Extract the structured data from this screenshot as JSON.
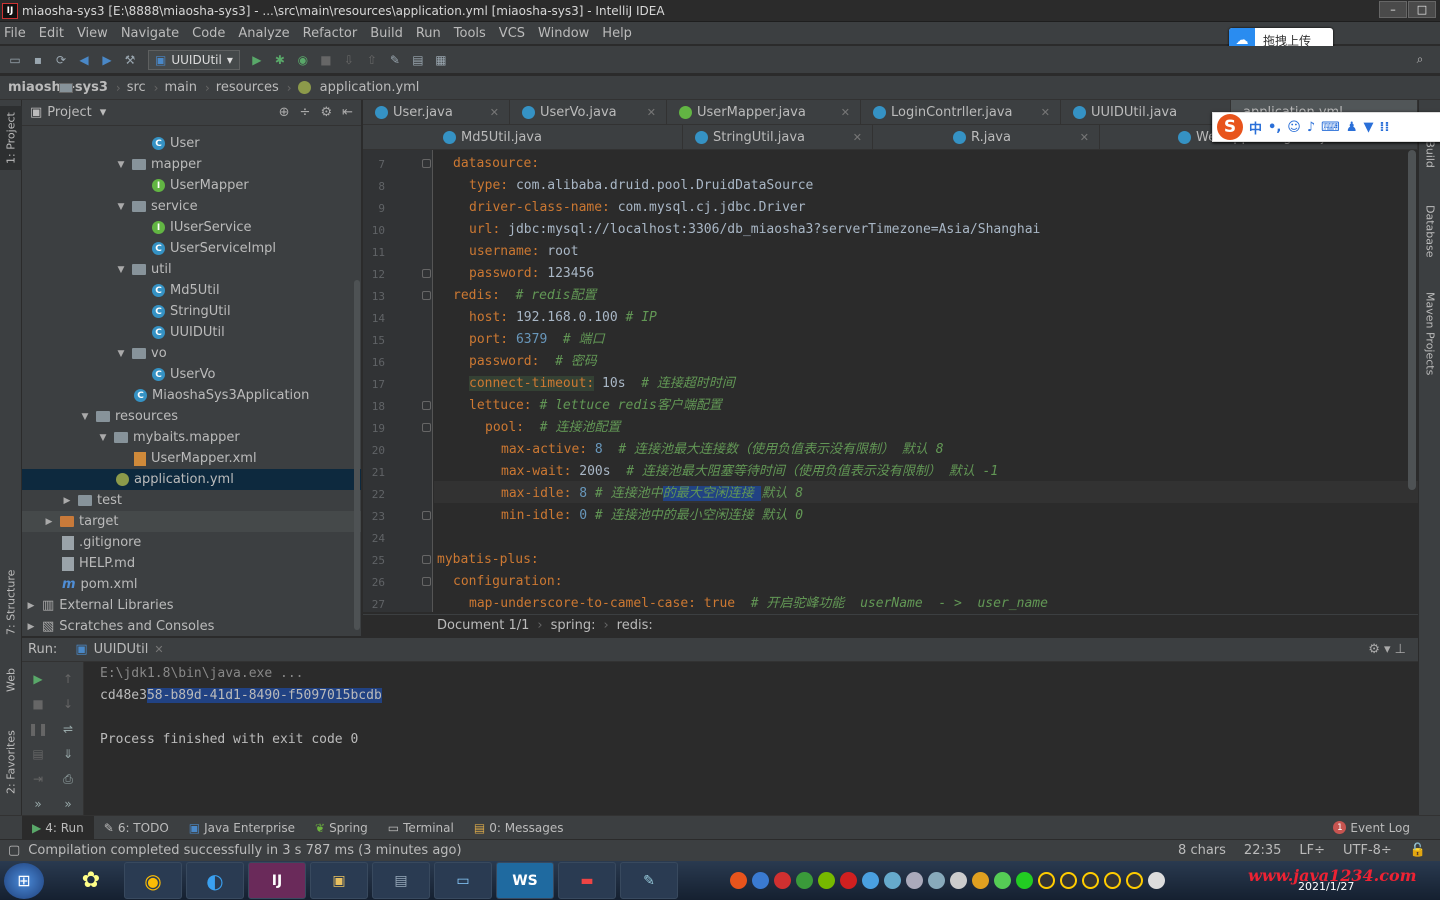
{
  "window": {
    "title": "miaosha-sys3 [E:\\8888\\miaosha-sys3] - ...\\src\\main\\resources\\application.yml [miaosha-sys3] - IntelliJ IDEA",
    "controls": [
      "–",
      "□",
      "✕"
    ]
  },
  "menu": [
    "File",
    "Edit",
    "View",
    "Navigate",
    "Code",
    "Analyze",
    "Refactor",
    "Build",
    "Run",
    "Tools",
    "VCS",
    "Window",
    "Help"
  ],
  "upload_widget": {
    "label": "拖拽上传"
  },
  "toolbar": {
    "run_config": "UUIDUtil"
  },
  "breadcrumb": [
    "miaosha-sys3",
    "src",
    "main",
    "resources",
    "application.yml"
  ],
  "project_panel": {
    "title": "Project",
    "items": [
      {
        "label": "User",
        "indent": 8
      },
      {
        "label": "mapper",
        "indent": 6
      },
      {
        "label": "UserMapper",
        "indent": 8
      },
      {
        "label": "service",
        "indent": 6
      },
      {
        "label": "IUserService",
        "indent": 8
      },
      {
        "label": "UserServiceImpl",
        "indent": 8
      },
      {
        "label": "util",
        "indent": 6
      },
      {
        "label": "Md5Util",
        "indent": 8
      },
      {
        "label": "StringUtil",
        "indent": 8
      },
      {
        "label": "UUIDUtil",
        "indent": 8
      },
      {
        "label": "vo",
        "indent": 6
      },
      {
        "label": "UserVo",
        "indent": 8
      },
      {
        "label": "MiaoshaSys3Application",
        "indent": 7
      },
      {
        "label": "resources",
        "indent": 4
      },
      {
        "label": "mybaits.mapper",
        "indent": 5
      },
      {
        "label": "UserMapper.xml",
        "indent": 7
      },
      {
        "label": "application.yml",
        "indent": 6
      },
      {
        "label": "test",
        "indent": 3
      },
      {
        "label": "target",
        "indent": 2
      },
      {
        "label": ".gitignore",
        "indent": 3
      },
      {
        "label": "HELP.md",
        "indent": 3
      },
      {
        "label": "pom.xml",
        "indent": 3
      },
      {
        "label": "External Libraries",
        "indent": 1
      },
      {
        "label": "Scratches and Consoles",
        "indent": 1
      }
    ]
  },
  "tabs_row1": [
    "User.java",
    "UserVo.java",
    "UserMapper.java",
    "LoginContrller.java",
    "UUIDUtil.java",
    "application.yml"
  ],
  "tabs_row2": [
    "Md5Util.java",
    "StringUtil.java",
    "R.java",
    "WebAppConfigurer.java"
  ],
  "editor": {
    "line_numbers": [
      "7",
      "8",
      "9",
      "10",
      "11",
      "12",
      "13",
      "14",
      "15",
      "16",
      "17",
      "18",
      "19",
      "20",
      "21",
      "22",
      "23",
      "24",
      "25",
      "26",
      "27"
    ],
    "breadcrumb": [
      "Document 1/1",
      "spring:",
      "redis:"
    ]
  },
  "left_tool_windows": [
    "1: Project",
    "7: Structure",
    "Web",
    "2: Favorites"
  ],
  "right_tool_windows": [
    "Ant Build",
    "Database",
    "Maven Projects"
  ],
  "run_panel": {
    "label": "Run:",
    "tab": "UUIDUtil",
    "console": [
      "E:\\jdk1.8\\bin\\java.exe ...",
      "cd48e358-b89d-41d1-8490-f5097015bcdb",
      "",
      "Process finished with exit code 0"
    ]
  },
  "bottom_tabs": [
    "4: Run",
    "6: TODO",
    "Java Enterprise",
    "Spring",
    "Terminal",
    "0: Messages"
  ],
  "event_log": {
    "count": "1",
    "label": "Event Log"
  },
  "status": {
    "message": "Compilation completed successfully in 3 s 787 ms (3 minutes ago)",
    "chars": "8 chars",
    "position": "22:35",
    "line_sep": "LF÷",
    "encoding": "UTF-8÷"
  },
  "taskbar": {
    "apps": [
      "IJ",
      "WS"
    ],
    "watermark": "www.java1234.com",
    "date": "2021/1/27"
  },
  "ime": {
    "mode": "中"
  }
}
